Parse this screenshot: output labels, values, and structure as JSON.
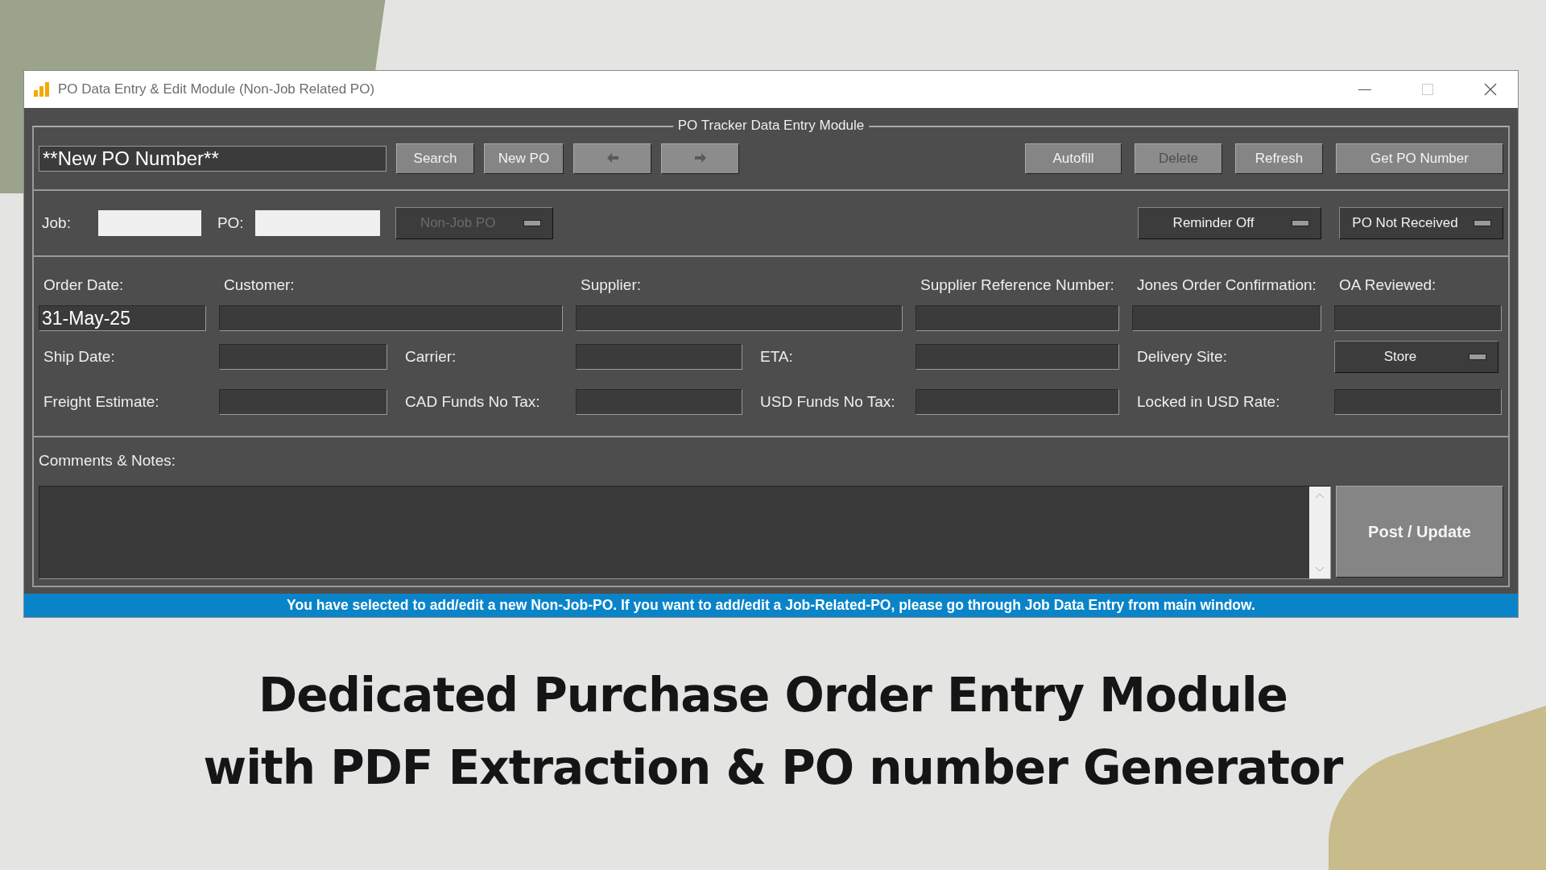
{
  "window": {
    "title": "PO Data Entry & Edit Module (Non-Job Related PO)"
  },
  "group_title": "PO Tracker Data Entry Module",
  "toolbar": {
    "po_number": {
      "value": "**New PO Number**"
    },
    "left_buttons": [
      {
        "kind": "text",
        "label": "Search",
        "disabled": false
      },
      {
        "kind": "text",
        "label": "New PO",
        "disabled": false
      },
      {
        "kind": "arrow-left",
        "disabled": true
      },
      {
        "kind": "arrow-right",
        "disabled": true
      }
    ],
    "right_buttons": [
      {
        "kind": "text",
        "label": "Autofill",
        "disabled": false
      },
      {
        "kind": "text",
        "label": "Delete",
        "disabled": true
      },
      {
        "kind": "text",
        "label": "Refresh",
        "disabled": false
      },
      {
        "kind": "text",
        "label": "Get PO Number",
        "disabled": false
      }
    ]
  },
  "job_row": {
    "job_label": "Job:",
    "po_label": "PO:",
    "type_dropdown": {
      "value": "Non-Job PO",
      "disabled": true
    },
    "reminder_dropdown": {
      "value": "Reminder Off",
      "disabled": false
    },
    "status_dropdown": {
      "value": "PO Not Received",
      "disabled": false
    }
  },
  "headings": [
    "Order Date:",
    "Customer:",
    "Supplier:",
    "Supplier Reference Number:",
    "Jones Order Confirmation:",
    "OA Reviewed:"
  ],
  "order_date": {
    "value": "31-May-25"
  },
  "rows": [
    {
      "cells": [
        {
          "kind": "label",
          "text": "Ship Date:"
        },
        {
          "kind": "field"
        },
        {
          "kind": "label",
          "text": "Carrier:"
        },
        {
          "kind": "field"
        },
        {
          "kind": "label",
          "text": "ETA:"
        },
        {
          "kind": "field"
        },
        {
          "kind": "label",
          "text": "Delivery Site:"
        },
        {
          "kind": "dropdown",
          "value": "Store",
          "disabled": false
        }
      ]
    },
    {
      "cells": [
        {
          "kind": "label",
          "text": "Freight Estimate:"
        },
        {
          "kind": "field"
        },
        {
          "kind": "label",
          "text": "CAD Funds No Tax:"
        },
        {
          "kind": "field"
        },
        {
          "kind": "label",
          "text": "USD Funds No Tax:"
        },
        {
          "kind": "field"
        },
        {
          "kind": "label",
          "text": "Locked in USD Rate:"
        },
        {
          "kind": "field"
        }
      ]
    }
  ],
  "comments": {
    "label": "Comments & Notes:"
  },
  "post_button": {
    "label": "Post / Update"
  },
  "status_bar": {
    "text": "You have selected to add/edit a new Non-Job-PO. If you want to add/edit a Job-Related-PO, please go through Job Data Entry from main window."
  },
  "caption": [
    "Dedicated Purchase Order Entry Module",
    "with PDF Extraction & PO number Generator"
  ]
}
